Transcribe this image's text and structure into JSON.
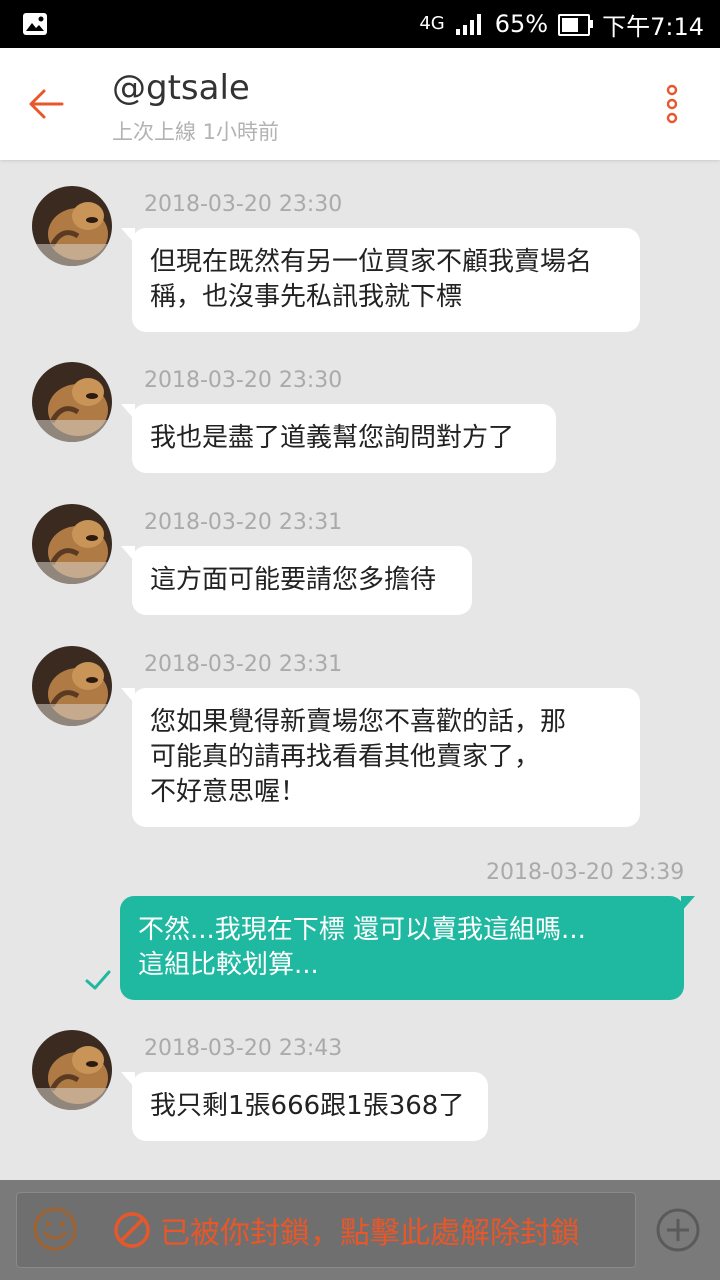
{
  "status_bar": {
    "network": "4G",
    "battery": "65%",
    "battery_level": 0.65,
    "time": "下午7:14"
  },
  "header": {
    "title": "@gtsale",
    "subtitle": "上次上線 1小時前"
  },
  "messages": [
    {
      "direction": "in",
      "timestamp": "2018-03-20 23:30",
      "lines": [
        "但現在既然有另一位買家不顧我賣場名",
        "稱，也沒事先私訊我就下標"
      ]
    },
    {
      "direction": "in",
      "timestamp": "2018-03-20 23:30",
      "lines": [
        "我也是盡了道義幫您詢問對方了"
      ]
    },
    {
      "direction": "in",
      "timestamp": "2018-03-20 23:31",
      "lines": [
        "這方面可能要請您多擔待"
      ]
    },
    {
      "direction": "in",
      "timestamp": "2018-03-20 23:31",
      "lines": [
        "您如果覺得新賣場您不喜歡的話，那",
        "可能真的請再找看看其他賣家了，",
        "不好意思喔！"
      ]
    },
    {
      "direction": "out",
      "timestamp": "2018-03-20 23:39",
      "lines": [
        "不然...我現在下標 還可以賣我這組嗎...",
        "這組比較划算..."
      ]
    },
    {
      "direction": "in",
      "timestamp": "2018-03-20 23:43",
      "lines": [
        "我只剩1張666跟1張368了"
      ]
    }
  ],
  "footer": {
    "blocked_text": "已被你封鎖，點擊此處解除封鎖"
  },
  "icons": {
    "back": "arrow-left-icon",
    "menu": "more-vertical-icon",
    "emoji": "smiley-icon",
    "blocked": "prohibited-icon",
    "add": "plus-circle-icon",
    "read": "check-icon"
  },
  "colors": {
    "accent": "#e8572a",
    "outgoing_bubble": "#1fb8a0",
    "chat_background": "#e6e6e6"
  }
}
